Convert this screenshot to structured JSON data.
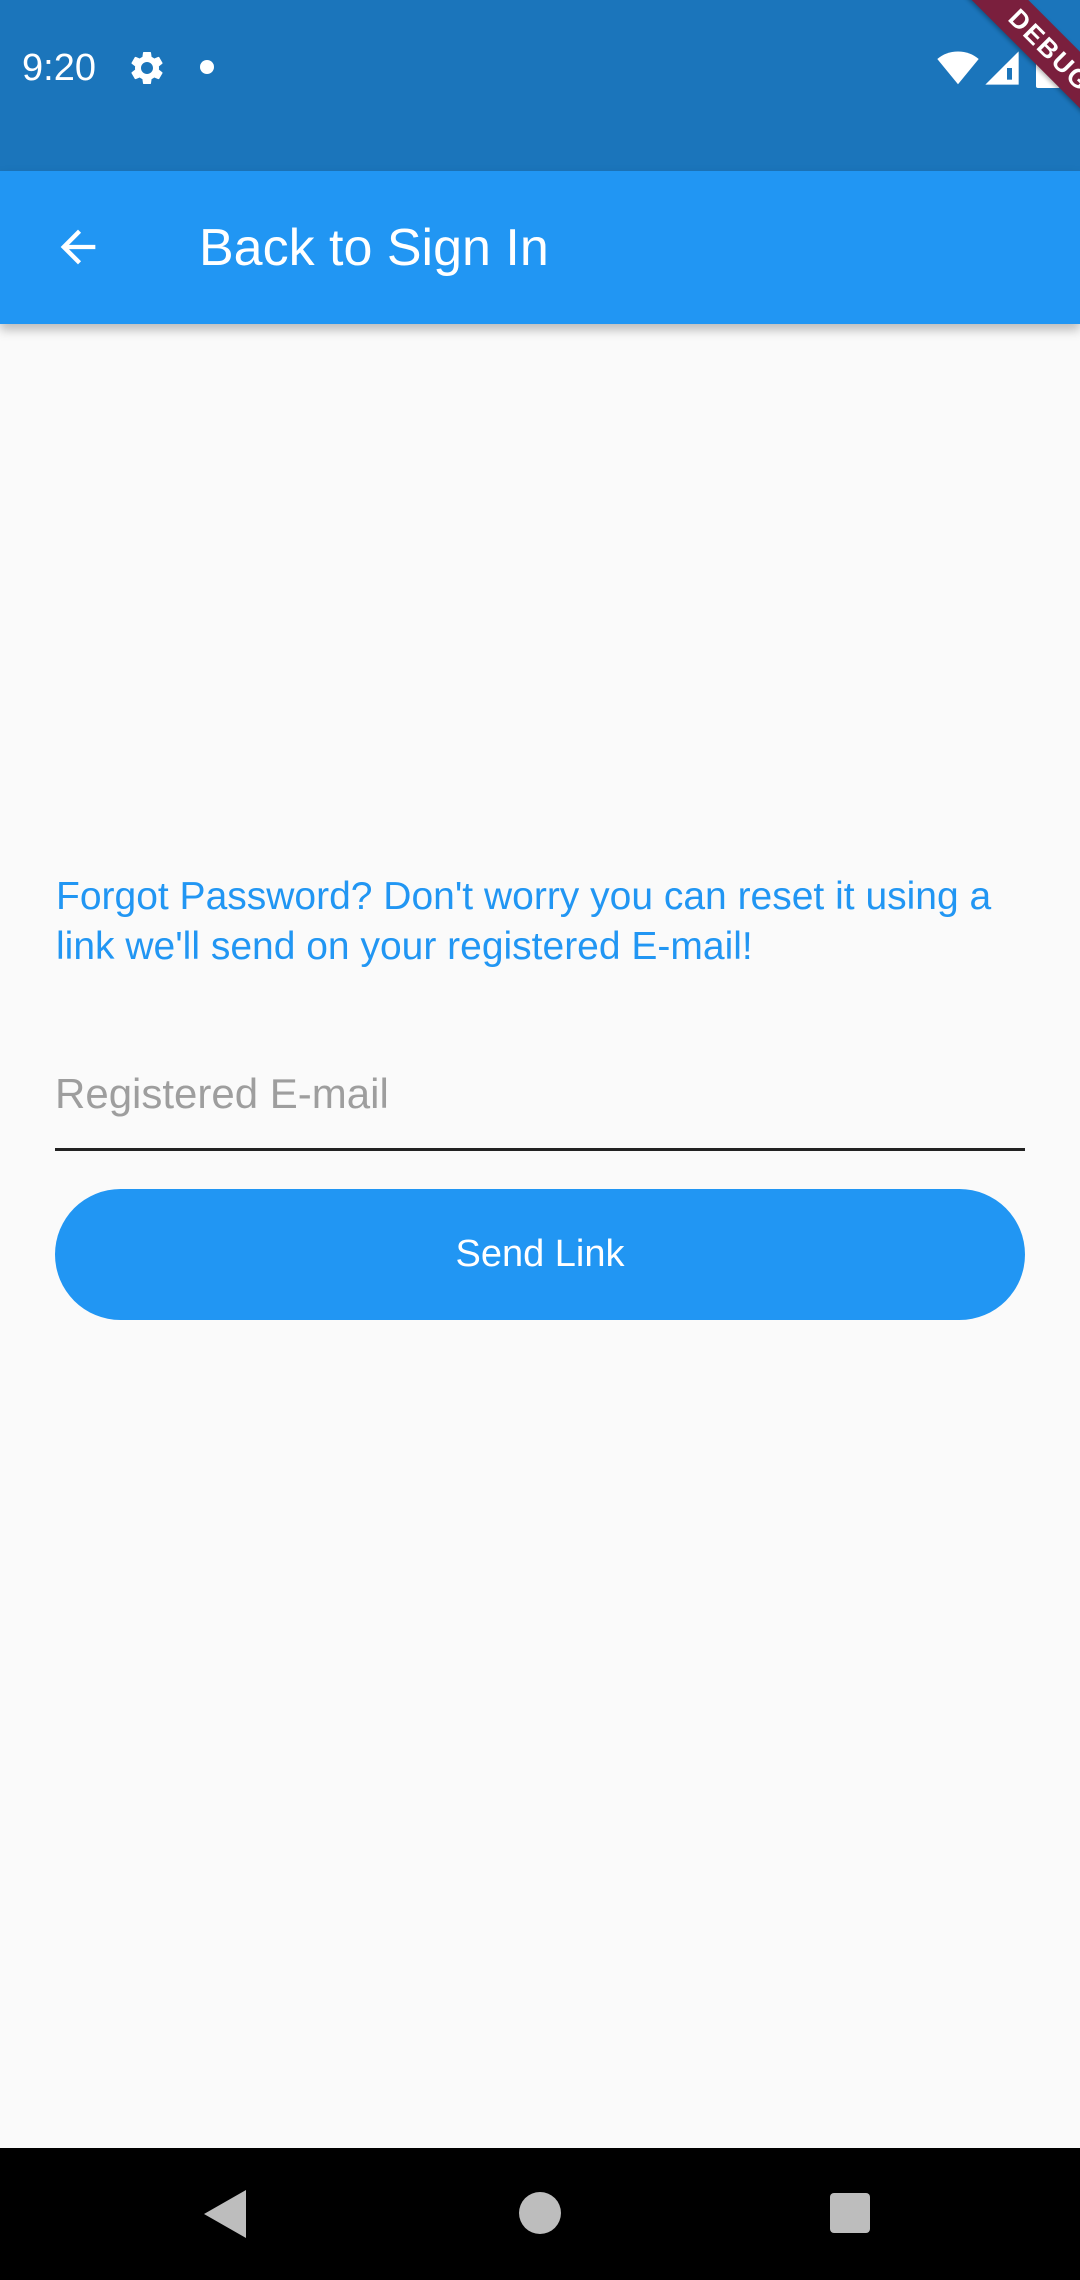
{
  "status_bar": {
    "time": "9:20",
    "icons": [
      "gear-icon",
      "notification-dot-icon",
      "wifi-icon",
      "signal-icon",
      "battery-icon"
    ],
    "background": "#1b75bb"
  },
  "debug_banner": {
    "label": "DEBUG"
  },
  "app_bar": {
    "title": "Back to Sign In",
    "back_icon": "arrow-back-icon",
    "background": "#2196f3"
  },
  "main": {
    "info_text": "Forgot Password? Don't worry you can reset it using a link we'll send on your registered E-mail!",
    "email_placeholder": "Registered E-mail",
    "email_value": "",
    "send_button_label": "Send Link",
    "accent_color": "#2196f3"
  },
  "nav_bar": {
    "icons": [
      "nav-back-icon",
      "nav-home-icon",
      "nav-recents-icon"
    ]
  }
}
